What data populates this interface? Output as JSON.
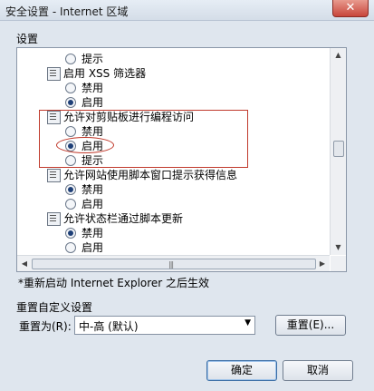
{
  "window": {
    "title": "安全设置 - Internet 区域",
    "close_label": "✕"
  },
  "settings_label": "设置",
  "items": [
    {
      "kind": "radio",
      "label": "提示",
      "checked": false
    },
    {
      "kind": "category",
      "label": "启用 XSS 筛选器"
    },
    {
      "kind": "radio",
      "label": "禁用",
      "checked": false
    },
    {
      "kind": "radio",
      "label": "启用",
      "checked": true
    },
    {
      "kind": "category",
      "label": "允许对剪贴板进行编程访问"
    },
    {
      "kind": "radio",
      "label": "禁用",
      "checked": false
    },
    {
      "kind": "radio",
      "label": "启用",
      "checked": true
    },
    {
      "kind": "radio",
      "label": "提示",
      "checked": false
    },
    {
      "kind": "category",
      "label": "允许网站使用脚本窗口提示获得信息"
    },
    {
      "kind": "radio",
      "label": "禁用",
      "checked": true
    },
    {
      "kind": "radio",
      "label": "启用",
      "checked": false
    },
    {
      "kind": "category",
      "label": "允许状态栏通过脚本更新"
    },
    {
      "kind": "radio",
      "label": "禁用",
      "checked": true
    },
    {
      "kind": "radio",
      "label": "启用",
      "checked": false
    }
  ],
  "notice": "*重新启动 Internet Explorer 之后生效",
  "reset_group": {
    "title": "重置自定义设置",
    "reset_to_label": "重置为(R):",
    "dropdown_value": "中-高 (默认)",
    "reset_button": "重置(E)..."
  },
  "buttons": {
    "ok": "确定",
    "cancel": "取消"
  },
  "colors": {
    "highlight": "#c0392b",
    "radio_dot": "#1e3f77"
  }
}
